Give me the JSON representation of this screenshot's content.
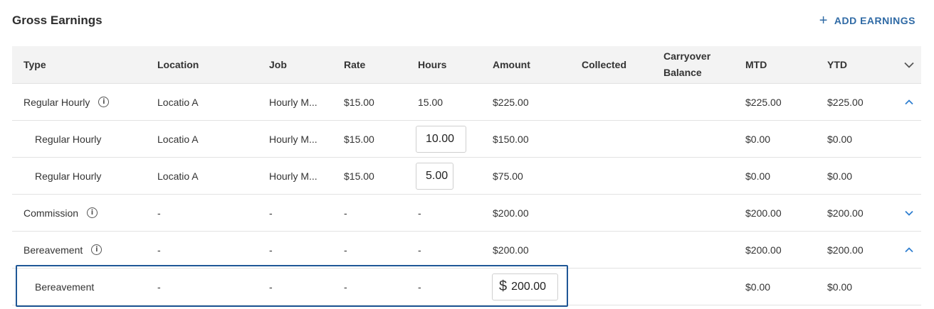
{
  "header": {
    "title": "Gross Earnings",
    "add_label": "ADD EARNINGS",
    "add_icon": "plus-icon"
  },
  "columns": {
    "type": "Type",
    "location": "Location",
    "job": "Job",
    "rate": "Rate",
    "hours": "Hours",
    "amount": "Amount",
    "collected": "Collected",
    "carryover_1": "Carryover",
    "carryover_2": "Balance",
    "mtd": "MTD",
    "ytd": "YTD"
  },
  "rows": [
    {
      "type": "Regular Hourly",
      "location": "Locatio A",
      "job": "Hourly M...",
      "rate": "$15.00",
      "hours": "15.00",
      "amount": "$225.00",
      "mtd": "$225.00",
      "ytd": "$225.00"
    },
    {
      "type": "Regular Hourly",
      "location": "Locatio A",
      "job": "Hourly M...",
      "rate": "$15.00",
      "hours": "10.00",
      "amount": "$150.00",
      "mtd": "$0.00",
      "ytd": "$0.00"
    },
    {
      "type": "Regular Hourly",
      "location": "Locatio A",
      "job": "Hourly M...",
      "rate": "$15.00",
      "hours": "5.00",
      "amount": "$75.00",
      "mtd": "$0.00",
      "ytd": "$0.00"
    },
    {
      "type": "Commission",
      "location": "-",
      "job": "-",
      "rate": "-",
      "hours": "-",
      "amount": "$200.00",
      "mtd": "$200.00",
      "ytd": "$200.00"
    },
    {
      "type": "Bereavement",
      "location": "-",
      "job": "-",
      "rate": "-",
      "hours": "-",
      "amount": "$200.00",
      "mtd": "$200.00",
      "ytd": "$200.00"
    },
    {
      "type": "Bereavement",
      "location": "-",
      "job": "-",
      "rate": "-",
      "hours": "-",
      "amount": "200.00",
      "currency": "$",
      "mtd": "$0.00",
      "ytd": "$0.00"
    }
  ],
  "colors": {
    "accent": "#2f6aa5",
    "chevron": "#2f7fd0",
    "header_bg": "#f3f3f3",
    "highlight": "#1f5796"
  }
}
